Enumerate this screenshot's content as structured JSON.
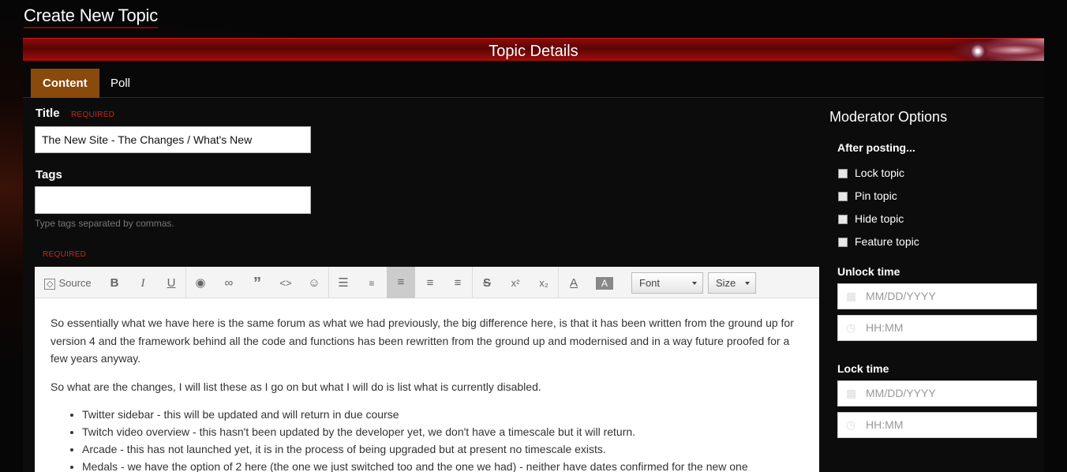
{
  "page_title": "Create New Topic",
  "panel_title": "Topic Details",
  "tabs": [
    {
      "label": "Content"
    },
    {
      "label": "Poll"
    }
  ],
  "form": {
    "title_label": "Title",
    "required": "REQUIRED",
    "title_value": "The New Site - The Changes / What's New",
    "tags_label": "Tags",
    "tags_value": "",
    "tags_hint": "Type tags separated by commas.",
    "editor_required": "REQUIRED"
  },
  "toolbar": {
    "source": "Source",
    "font": "Font",
    "size": "Size",
    "icons": [
      "source-icon",
      "bold-icon",
      "italic-icon",
      "underline-icon",
      "preview-icon",
      "link-icon",
      "quote-icon",
      "code-icon",
      "emoji-icon",
      "bulleted-list-icon",
      "numbered-list-icon",
      "align-left-icon",
      "align-center-icon",
      "align-right-icon",
      "strikethrough-icon",
      "superscript-icon",
      "subscript-icon",
      "text-color-icon",
      "background-color-icon"
    ]
  },
  "editor": {
    "paragraphs": [
      "So essentially what we have here is the same forum as what we had previously, the big difference here, is that it has been written from the ground up for version 4 and the framework behind all the code and functions has been rewritten from the ground up and modernised and in a way future proofed for a few years anyway.",
      "So what are the changes, I will list these as I go on but what I will do is list what is currently disabled."
    ],
    "bullets": [
      "Twitter sidebar - this will be updated and will return in due course",
      "Twitch video overview - this hasn't been updated by the developer yet, we don't have a timescale but it will return.",
      "Arcade - this has not launched yet, it is in the process of being upgraded but at present no timescale exists.",
      "Medals - we have the option of 2 here (the one we just switched too and the one we had) - neither have dates confirmed for the new one"
    ]
  },
  "moderator": {
    "title": "Moderator Options",
    "after_posting": "After posting...",
    "options": [
      "Lock topic",
      "Pin topic",
      "Hide topic",
      "Feature topic"
    ],
    "unlock_label": "Unlock time",
    "lock_label": "Lock time",
    "date_placeholder": "MM/DD/YYYY",
    "time_placeholder": "HH:MM"
  }
}
